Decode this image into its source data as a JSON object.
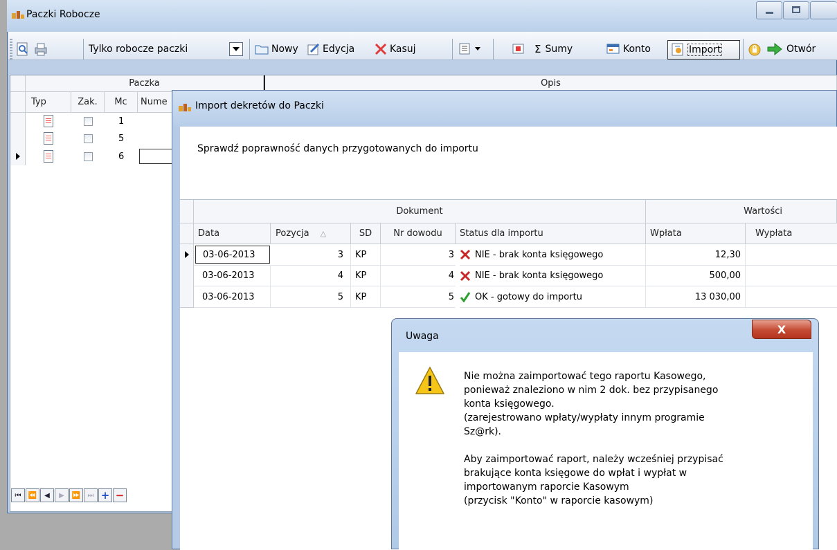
{
  "main_window": {
    "title": "Paczki Robocze"
  },
  "toolbar": {
    "filter_value": "Tylko robocze paczki",
    "new_label": "Nowy",
    "edit_label": "Edycja",
    "delete_label": "Kasuj",
    "sums_label": "Sumy",
    "account_label": "Konto",
    "import_label": "Import",
    "open_label": "Otwór"
  },
  "main_grid": {
    "group_headers": [
      "Paczka",
      "Opis"
    ],
    "columns": [
      "Typ",
      "Zak.",
      "Mc",
      "Nume"
    ],
    "rows": [
      {
        "mc": "1"
      },
      {
        "mc": "5"
      },
      {
        "mc": "6"
      }
    ]
  },
  "import_dialog": {
    "title": "Import dekretów do Paczki",
    "description": "Sprawdź poprawność danych przygotowanych do importu",
    "group_headers": [
      "Dokument",
      "Wartości"
    ],
    "columns": [
      "Data",
      "Pozycja",
      "SD",
      "Nr dowodu",
      "Status dla importu",
      "Wpłata",
      "Wypłata"
    ],
    "rows": [
      {
        "data": "03-06-2013",
        "pozycja": "3",
        "sd": "KP",
        "nr": "3",
        "status_ok": false,
        "status": "NIE - brak konta księgowego",
        "wplata": "12,30",
        "wyplata": ""
      },
      {
        "data": "03-06-2013",
        "pozycja": "4",
        "sd": "KP",
        "nr": "4",
        "status_ok": false,
        "status": "NIE - brak konta księgowego",
        "wplata": "500,00",
        "wyplata": ""
      },
      {
        "data": "03-06-2013",
        "pozycja": "5",
        "sd": "KP",
        "nr": "5",
        "status_ok": true,
        "status": "OK - gotowy do importu",
        "wplata": "13 030,00",
        "wyplata": ""
      }
    ]
  },
  "warning_dialog": {
    "title": "Uwaga",
    "close_glyph": "X",
    "message_lines_1": [
      "Nie można zaimportować tego raportu Kasowego,",
      "ponieważ znaleziono w nim 2 dok. bez przypisanego",
      "konta księgowego.",
      "(zarejestrowano wpłaty/wypłaty innym programie",
      "Sz@rk)."
    ],
    "message_lines_2": [
      "Aby zaimportować raport, należy wcześniej przypisać",
      "brakujące konta księgowe do wpłat i wypłat w",
      "importowanym raporcie Kasowym",
      "(przycisk \"Konto\" w raporcie kasowym)"
    ]
  },
  "colors": {
    "error": "#c62828",
    "ok": "#2e9e2e",
    "warning": "#f5c518"
  }
}
